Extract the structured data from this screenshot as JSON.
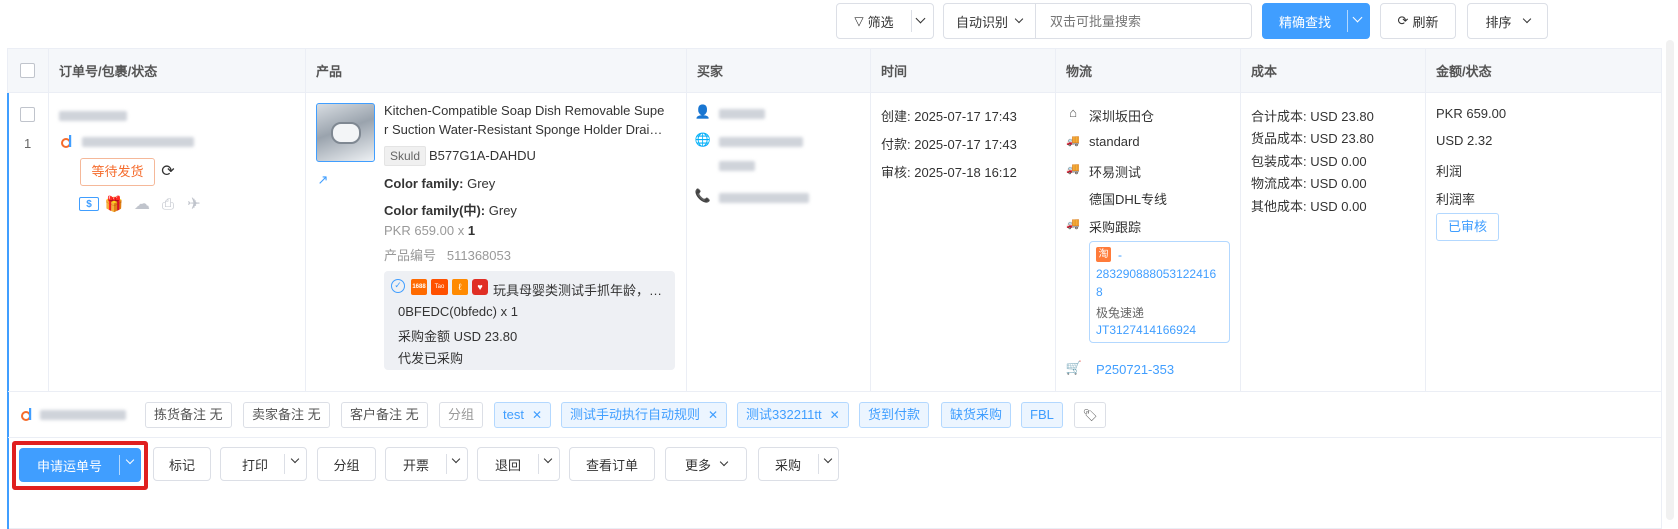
{
  "toolbar": {
    "filter_label": "筛选",
    "auto_detect_label": "自动识别",
    "search_placeholder": "双击可批量搜索",
    "precise_search_label": "精确查找",
    "refresh_label": "刷新",
    "sort_label": "排序"
  },
  "columns": [
    "订单号/包裹/状态",
    "产品",
    "买家",
    "时间",
    "物流",
    "成本",
    "金额/状态"
  ],
  "order": {
    "row_index": "1",
    "status_button": "等待发货",
    "product": {
      "title": "Kitchen-Compatible Soap Dish Removable Super Suction Water-Resistant Sponge Holder Drai…",
      "title_line1": "Kitchen-Compatible Soap Dish Removable Supe",
      "title_line2": "r Suction Water-Resistant Sponge Holder Drai…",
      "skuid_label": "Skuld",
      "skuid_value": "B577G1A-DAHDU",
      "attr1_label": "Color family:",
      "attr1_value": "Grey",
      "attr2_label": "Color family(中):",
      "attr2_value": "Grey",
      "price_qty_prefix": "PKR 659.00 x",
      "qty": "1",
      "code_label": "产品编号",
      "code_value": "511368053",
      "purchase_title": "玩具母婴类测试手抓年龄，…",
      "purchase_sku": "0BFEDC(0bfedc) x 1",
      "purchase_amount": "采购金额  USD  23.80",
      "purchase_status": "代发已采购",
      "source_icons": [
        "1688",
        "Tao",
        "Ali",
        "Pdd"
      ]
    },
    "time": {
      "created": "创建:  2025-07-17 17:43",
      "paid": "付款:  2025-07-17 17:43",
      "audited": "审核:  2025-07-18 16:12"
    },
    "logistics": {
      "warehouse": "深圳坂田仓",
      "service": "standard",
      "carrier": "环易测试",
      "line": "德国DHL专线",
      "tracking_label": "采购跟踪",
      "tracking_prefix": "-",
      "tracking_number_1": "283290888053122416",
      "tracking_number_2": "8",
      "courier": "极兔速递",
      "courier_number": "JT3127414166924",
      "purchase_order": "P250721-353"
    },
    "cost": {
      "total": "合计成本:  USD 23.80",
      "goods": "货品成本:  USD 23.80",
      "packing": "包装成本:  USD 0.00",
      "logistics": "物流成本:  USD 0.00",
      "other": "其他成本:  USD 0.00"
    },
    "amount": {
      "pkr": "PKR 659.00",
      "usd": "USD 2.32",
      "profit": "利润",
      "profit_rate": "利润率",
      "audit_status": "已审核"
    }
  },
  "remarks": {
    "picking": "拣货备注 无",
    "seller": "卖家备注 无",
    "customer": "客户备注 无",
    "group": "分组",
    "tags": [
      "test",
      "测试手动执行自动规则",
      "测试332211tt"
    ],
    "plain_tags": [
      "货到付款",
      "缺货采购",
      "FBL"
    ]
  },
  "actions": {
    "apply_waybill": "申请运单号",
    "mark": "标记",
    "print": "打印",
    "group": "分组",
    "invoice": "开票",
    "return": "退回",
    "view_order": "查看订单",
    "more": "更多",
    "purchase": "采购"
  },
  "colors": {
    "primary": "#409eff",
    "highlight_border": "#e01f1f",
    "status_orange": "#f56c2d"
  }
}
